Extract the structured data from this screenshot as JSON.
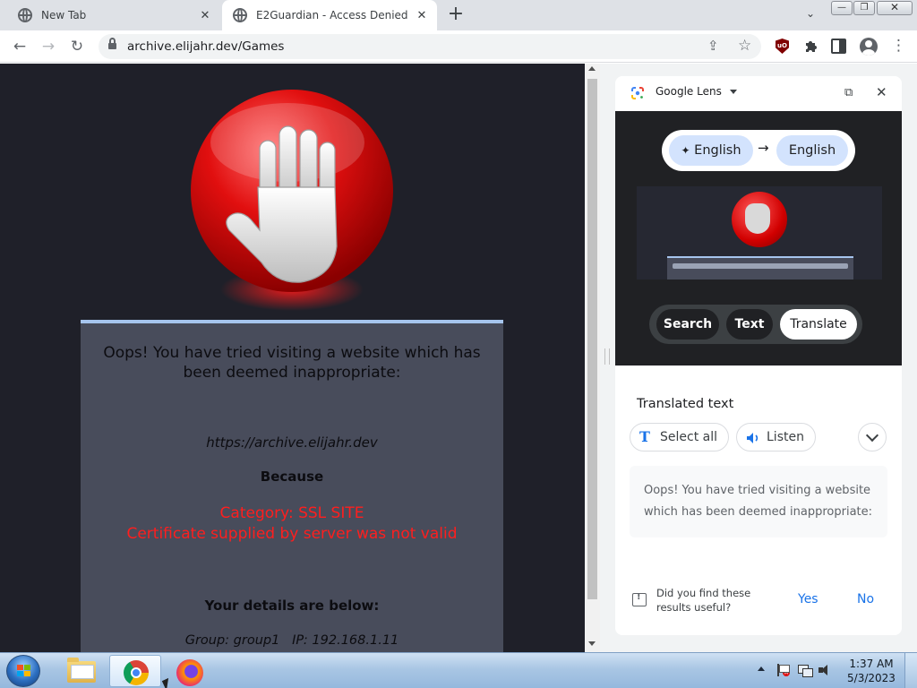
{
  "tabs": [
    {
      "title": "New Tab",
      "close": "✕"
    },
    {
      "title": "E2Guardian - Access Denied",
      "close": "✕"
    }
  ],
  "new_tab": "+",
  "tab_search": "⌄",
  "window": {
    "minimize": "—",
    "maximize": "❐",
    "close": "✕"
  },
  "toolbar": {
    "back": "←",
    "forward": "→",
    "reload": "↻",
    "url": "archive.elijahr.dev/Games",
    "share": "⇪",
    "star": "☆",
    "ublock_badge": "uO",
    "menu": "⋮"
  },
  "page": {
    "heading": "Oops! You have tried visiting a website which has been deemed inappropriate:",
    "blocked_url": "https://archive.elijahr.dev",
    "because": "Because",
    "category": "Category: SSL SITE",
    "reason": "Certificate supplied by server was not valid",
    "details_heading": "Your details are below:",
    "details_line": "Group: group1   IP: 192.168.1.11"
  },
  "lens": {
    "title": "Google Lens",
    "open_new": "⧉",
    "close": "✕",
    "source_lang": "English",
    "target_lang": "English",
    "arrow": "→",
    "sparkle": "✦",
    "modes": {
      "search": "Search",
      "text": "Text",
      "translate": "Translate"
    },
    "translated_label": "Translated text",
    "select_all": "Select all",
    "select_icon": "T",
    "listen": "Listen",
    "result": "Oops! You have tried visiting a website which has been deemed inappropriate:",
    "feedback_question": "Did you find these results useful?",
    "yes": "Yes",
    "no": "No"
  },
  "taskbar": {
    "time": "1:37 AM",
    "date": "5/3/2023"
  },
  "colors": {
    "page_background": "#1f2029",
    "card_background": "#484c5b",
    "card_accent": "#a6c5ee",
    "error_red": "#ff1e1e",
    "link_blue": "#1a73e8",
    "lang_chip": "#d3e3fd"
  },
  "icons": [
    "globe-icon",
    "lock-icon",
    "share-icon",
    "star-icon",
    "ublock-icon",
    "puzzle-icon",
    "side-panel-icon",
    "profile-icon",
    "menu-icon",
    "stop-hand-icon",
    "lens-logo-icon",
    "speaker-icon",
    "feedback-icon",
    "windows-start-icon",
    "folder-icon",
    "chrome-icon",
    "firefox-icon"
  ]
}
